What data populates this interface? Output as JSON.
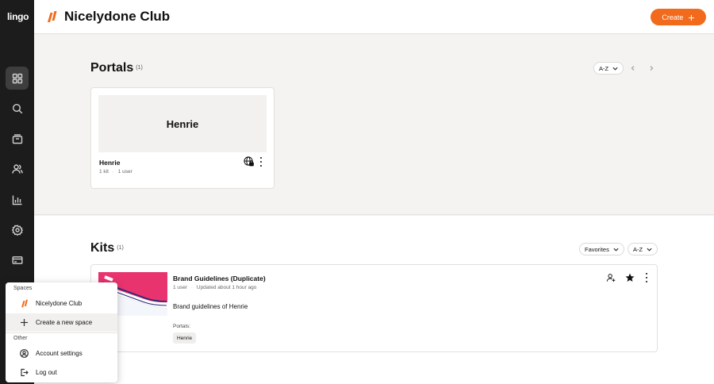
{
  "rail": {
    "logo": "lingo",
    "items": [
      {
        "icon": "grid-icon",
        "active": true
      },
      {
        "icon": "search-icon"
      },
      {
        "icon": "archive-icon"
      },
      {
        "icon": "users-icon"
      },
      {
        "icon": "analytics-icon"
      },
      {
        "icon": "gear-icon"
      },
      {
        "icon": "billing-card-icon"
      }
    ]
  },
  "header": {
    "title": "Nicelydone Club",
    "create_label": "Create",
    "accent": "#f26a1b"
  },
  "portals": {
    "title": "Portals",
    "count": "(1)",
    "sort_label": "A-Z",
    "cards": [
      {
        "thumb_title": "Henrie",
        "name": "Henrie",
        "kits": "1 kit",
        "users": "1 user"
      }
    ]
  },
  "kits": {
    "title": "Kits",
    "count": "(1)",
    "filter_label": "Favorites",
    "sort_label": "A-Z",
    "cards": [
      {
        "name": "Brand Guidelines (Duplicate)",
        "users": "1 user",
        "updated": "Updated about 1 hour ago",
        "description": "Brand guidelines of Henrie",
        "portals_label": "Portals:",
        "portal_tag": "Henrie"
      }
    ]
  },
  "menu": {
    "spaces_heading": "Spaces",
    "space_name": "Nicelydone Club",
    "create_space": "Create a new space",
    "other_heading": "Other",
    "account_settings": "Account settings",
    "logout": "Log out"
  }
}
